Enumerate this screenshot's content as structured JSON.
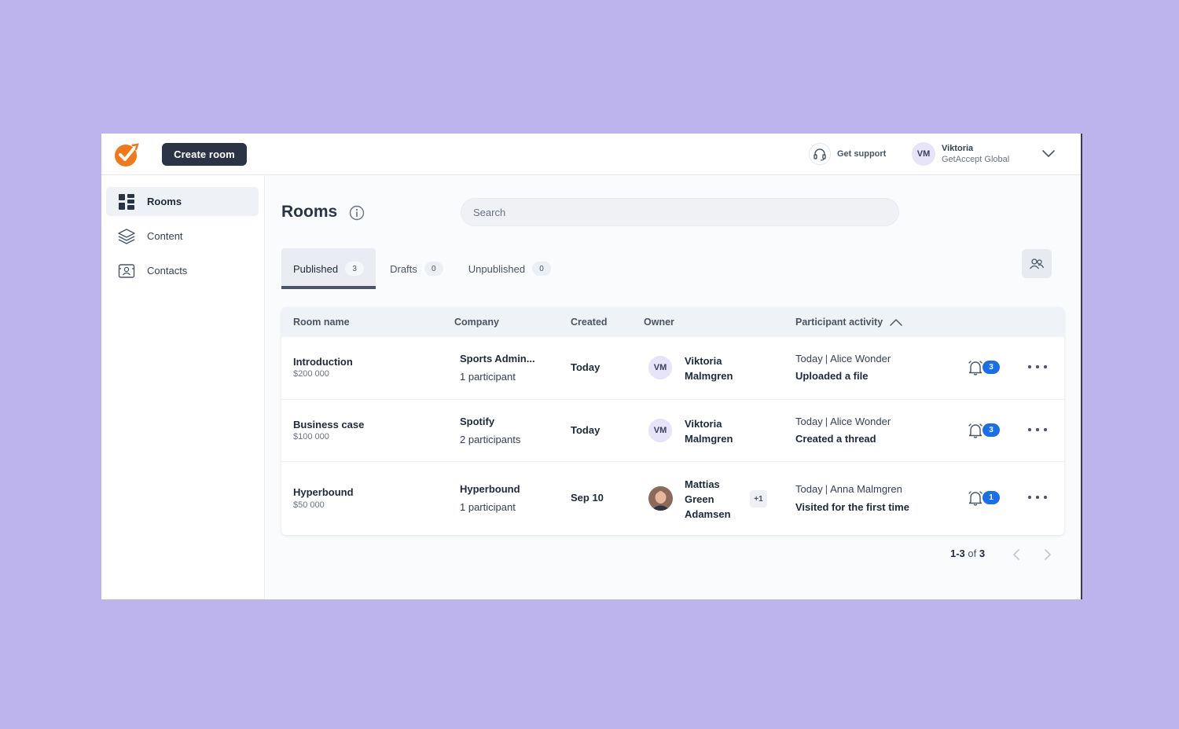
{
  "header": {
    "create_button": "Create room",
    "support_label": "Get support",
    "user": {
      "initials": "VM",
      "name": "Viktoria",
      "org": "GetAccept Global"
    }
  },
  "sidebar": {
    "items": [
      {
        "label": "Rooms",
        "icon": "grid-icon",
        "active": true
      },
      {
        "label": "Content",
        "icon": "layers-icon",
        "active": false
      },
      {
        "label": "Contacts",
        "icon": "contact-card-icon",
        "active": false
      }
    ]
  },
  "main": {
    "title": "Rooms",
    "search_placeholder": "Search",
    "tabs": [
      {
        "label": "Published",
        "count": "3"
      },
      {
        "label": "Drafts",
        "count": "0"
      },
      {
        "label": "Unpublished",
        "count": "0"
      }
    ],
    "columns": [
      "Room name",
      "Company",
      "Created",
      "Owner",
      "Participant activity"
    ],
    "rows": [
      {
        "room_name": "Introduction",
        "value": "$200 000",
        "company": "Sports Admin...",
        "participants": "1 participant",
        "created": "Today",
        "owner_initials": "VM",
        "owner_first": "Viktoria",
        "owner_last": "Malmgren",
        "activity_when": "Today",
        "activity_who": "Alice Wonder",
        "activity_what": "Uploaded a file",
        "notifications": "3"
      },
      {
        "room_name": "Business case",
        "value": "$100 000",
        "company": "Spotify",
        "participants": "2 participants",
        "created": "Today",
        "owner_initials": "VM",
        "owner_first": "Viktoria",
        "owner_last": "Malmgren",
        "activity_when": "Today",
        "activity_who": "Alice Wonder",
        "activity_what": "Created a thread",
        "notifications": "3"
      },
      {
        "room_name": "Hyperbound",
        "value": "$50 000",
        "company": "Hyperbound",
        "participants": "1 participant",
        "created": "Sep 10",
        "owner_line1": "Mattias",
        "owner_line2": "Green",
        "owner_line3": "Adamsen",
        "owner_extra": "+1",
        "activity_when": "Today",
        "activity_who": "Anna Malmgren",
        "activity_what": "Visited for the first time",
        "notifications": "1"
      }
    ],
    "pagination": {
      "range": "1-3",
      "of_word": "of",
      "total": "3"
    }
  },
  "colors": {
    "accent": "#f07a1a",
    "badge": "#1a6fe8",
    "primary_button": "#2b3444",
    "background": "#bdb4ee"
  }
}
